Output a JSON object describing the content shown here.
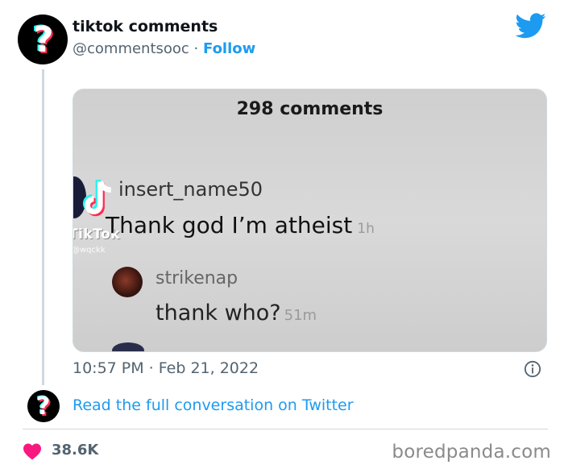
{
  "author": {
    "name": "tiktok comments",
    "handle": "@commentsooc",
    "separator": " · ",
    "follow_label": "Follow"
  },
  "icons": {
    "avatar": "question-mark-avatar",
    "platform": "twitter-bird-icon",
    "info": "info-icon",
    "like": "heart-icon"
  },
  "media": {
    "comments_count": "298 comments",
    "tiktok_watermark": "TikTok",
    "tiktok_handle": "@wqckk",
    "comment1": {
      "user": "insert_name50",
      "text": "Thank god I’m atheist",
      "time": "1h"
    },
    "comment2": {
      "user": "strikenap",
      "text": "thank who?",
      "time": "51m"
    }
  },
  "tweet": {
    "timestamp": "10:57 PM · Feb 21, 2022",
    "conversation_link": "Read the full conversation on Twitter",
    "like_count": "38.6K"
  },
  "watermark": "boredpanda.com",
  "colors": {
    "accent": "#1d9bf0",
    "text_primary": "#0f1419",
    "text_secondary": "#536471",
    "heart": "#f91880",
    "tiktok_cyan": "#25f4ee",
    "tiktok_red": "#fe2c55"
  }
}
